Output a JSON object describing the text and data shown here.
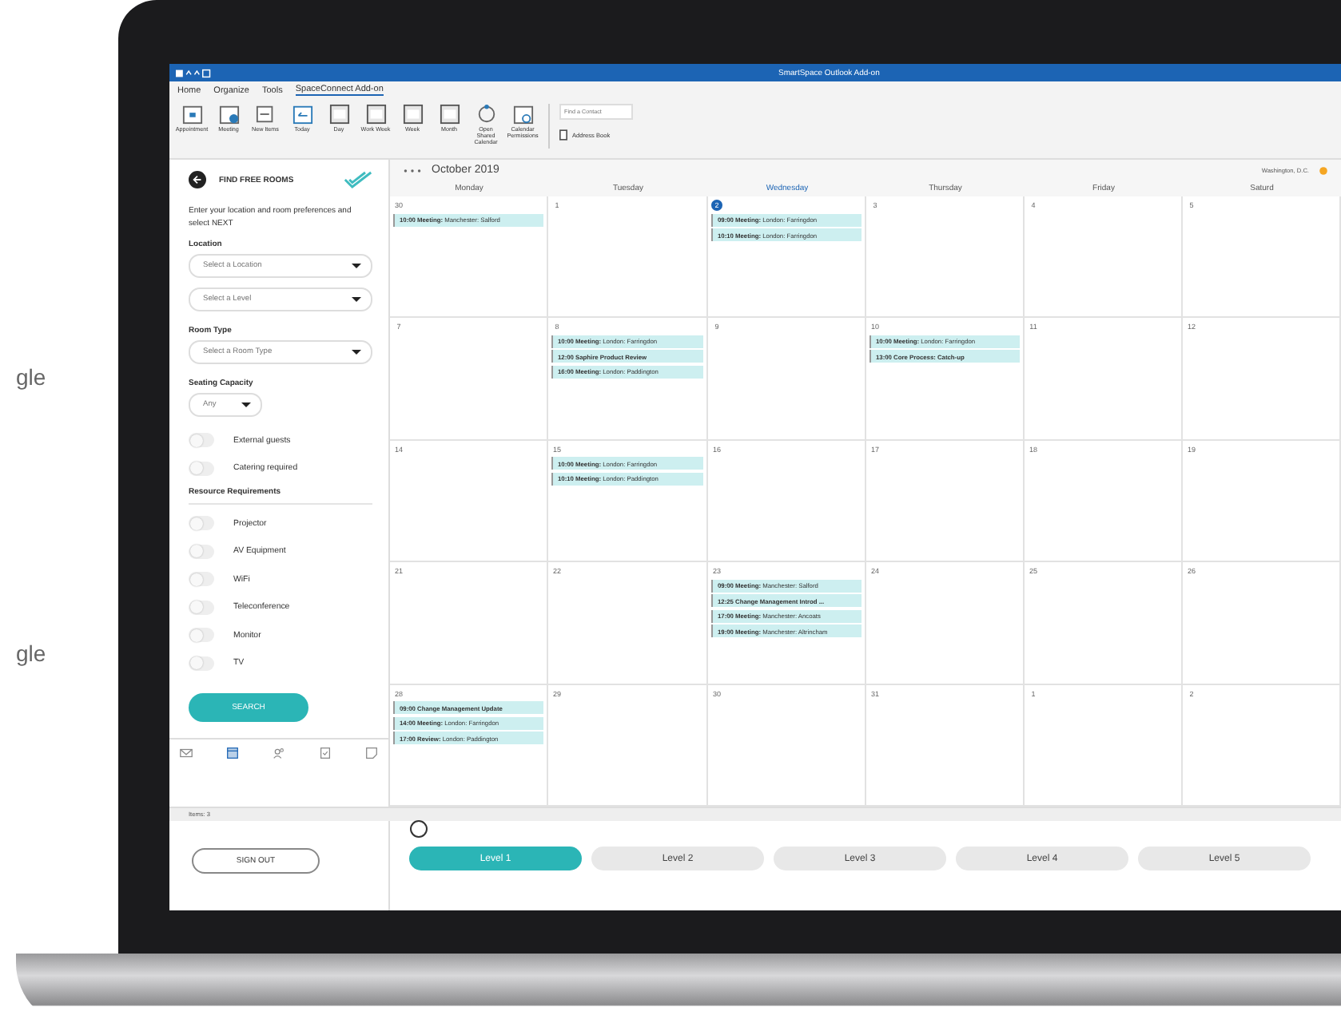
{
  "background_texts": [
    "gle",
    "gle"
  ],
  "window": {
    "title": "SmartSpace Outlook Add-on"
  },
  "menu": [
    {
      "label": "Home",
      "selected": false
    },
    {
      "label": "Organize",
      "selected": false
    },
    {
      "label": "Tools",
      "selected": false
    },
    {
      "label": "SpaceConnect Add-on",
      "selected": true
    }
  ],
  "ribbon": {
    "buttons": [
      {
        "label": "Appointment",
        "kind": "calendar"
      },
      {
        "label": "Meeting",
        "kind": "meeting"
      },
      {
        "label": "New Items",
        "kind": "new"
      },
      {
        "label": "Today",
        "kind": "today"
      },
      {
        "label": "Day",
        "kind": "view"
      },
      {
        "label": "Work Week",
        "kind": "view"
      },
      {
        "label": "Week",
        "kind": "view"
      },
      {
        "label": "Month",
        "kind": "view"
      },
      {
        "label": "Open Shared Calendar",
        "kind": "shared"
      },
      {
        "label": "Calendar Permissions",
        "kind": "permissions"
      }
    ],
    "contact_search": {
      "placeholder": "Find a Contact"
    },
    "address_book": "Address Book"
  },
  "sidebar": {
    "title": "FIND FREE ROOMS",
    "intro": "Enter your location and room preferences and select NEXT",
    "location_label": "Location",
    "location_selects": [
      {
        "placeholder": "Select a Location"
      },
      {
        "placeholder": "Select a Level"
      }
    ],
    "room_type_label": "Room Type",
    "room_type_select": {
      "placeholder": "Select a Room Type"
    },
    "capacity_label": "Seating Capacity",
    "capacity_select": {
      "value": "Any"
    },
    "toggles": [
      {
        "label": "External guests",
        "on": false
      },
      {
        "label": "Catering required",
        "on": false
      }
    ],
    "resources_label": "Resource Requirements",
    "resources": [
      {
        "label": "Projector",
        "on": false
      },
      {
        "label": "AV Equipment",
        "on": false
      },
      {
        "label": "WiFi",
        "on": false
      },
      {
        "label": "Teleconference",
        "on": false
      },
      {
        "label": "Monitor",
        "on": false
      },
      {
        "label": "TV",
        "on": false
      }
    ],
    "search_button": "SEARCH",
    "nav": [
      {
        "kind": "mail",
        "selected": false
      },
      {
        "kind": "calendar",
        "selected": true
      },
      {
        "kind": "people",
        "selected": false
      },
      {
        "kind": "tasks",
        "selected": false
      },
      {
        "kind": "notes",
        "selected": false
      }
    ]
  },
  "status_bar": "Items: 3",
  "calendar": {
    "month": "October 2019",
    "location": "Washington, D.C.",
    "day_headers": [
      {
        "label": "Monday",
        "current": false
      },
      {
        "label": "Tuesday",
        "current": false
      },
      {
        "label": "Wednesday",
        "current": true
      },
      {
        "label": "Thursday",
        "current": false
      },
      {
        "label": "Friday",
        "current": false
      },
      {
        "label": "Saturd",
        "current": false
      }
    ],
    "weeks": [
      [
        {
          "date": "30",
          "today": false,
          "events": [
            {
              "time": "10:00",
              "title": "Meeting:",
              "detail": "Manchester: Salford"
            }
          ]
        },
        {
          "date": "1",
          "today": false
        },
        {
          "date": "2",
          "today": true,
          "events": [
            {
              "time": "09:00",
              "title": "Meeting:",
              "detail": "London: Farringdon"
            },
            {
              "time": "10:10",
              "title": "Meeting:",
              "detail": "London: Farringdon"
            }
          ]
        },
        {
          "date": "3",
          "today": false
        },
        {
          "date": "4",
          "today": false
        },
        {
          "date": "5",
          "today": false
        }
      ],
      [
        {
          "date": "7",
          "today": false
        },
        {
          "date": "8",
          "today": false,
          "events": [
            {
              "time": "10:00",
              "title": "Meeting:",
              "detail": "London: Farringdon"
            },
            {
              "time": "12:00",
              "title": "Saphire Product Review"
            },
            {
              "time": "16:00",
              "title": "Meeting:",
              "detail": "London: Paddington"
            }
          ]
        },
        {
          "date": "9",
          "today": false
        },
        {
          "date": "10",
          "today": false,
          "events": [
            {
              "time": "10:00",
              "title": "Meeting:",
              "detail": "London: Farringdon"
            },
            {
              "time": "13:00",
              "title": "Core Process: Catch-up"
            }
          ]
        },
        {
          "date": "11",
          "today": false
        },
        {
          "date": "12",
          "today": false
        }
      ],
      [
        {
          "date": "14",
          "today": false
        },
        {
          "date": "15",
          "today": false,
          "events": [
            {
              "time": "10:00",
              "title": "Meeting:",
              "detail": "London: Farringdon"
            },
            {
              "time": "10:10",
              "title": "Meeting:",
              "detail": "London: Paddington"
            }
          ]
        },
        {
          "date": "16",
          "today": false
        },
        {
          "date": "17",
          "today": false
        },
        {
          "date": "18",
          "today": false
        },
        {
          "date": "19",
          "today": false
        }
      ],
      [
        {
          "date": "21",
          "today": false
        },
        {
          "date": "22",
          "today": false
        },
        {
          "date": "23",
          "today": false,
          "events": [
            {
              "time": "09:00",
              "title": "Meeting:",
              "detail": "Manchester: Salford"
            },
            {
              "time": "12:25",
              "title": "Change Management Introd ..."
            },
            {
              "time": "17:00",
              "title": "Meeting:",
              "detail": "Manchester: Ancoats"
            },
            {
              "time": "19:00",
              "title": "Meeting:",
              "detail": "Manchester: Altrincham"
            }
          ]
        },
        {
          "date": "24",
          "today": false
        },
        {
          "date": "25",
          "today": false
        },
        {
          "date": "26",
          "today": false
        }
      ],
      [
        {
          "date": "28",
          "today": false,
          "events": [
            {
              "time": "09:00",
              "title": "Change Management Update"
            },
            {
              "time": "14:00",
              "title": "Meeting:",
              "detail": "London: Farringdon"
            },
            {
              "time": "17:00",
              "title": "Review:",
              "detail": "London: Paddington"
            }
          ]
        },
        {
          "date": "29",
          "today": false
        },
        {
          "date": "30",
          "today": false
        },
        {
          "date": "31",
          "today": false
        },
        {
          "date": "1",
          "today": false
        },
        {
          "date": "2",
          "today": false
        }
      ]
    ]
  },
  "sign_out": "SIGN OUT",
  "levels": [
    {
      "label": "Level 1",
      "selected": true
    },
    {
      "label": "Level 2",
      "selected": false
    },
    {
      "label": "Level 3",
      "selected": false
    },
    {
      "label": "Level 4",
      "selected": false
    },
    {
      "label": "Level 5",
      "selected": false
    }
  ]
}
